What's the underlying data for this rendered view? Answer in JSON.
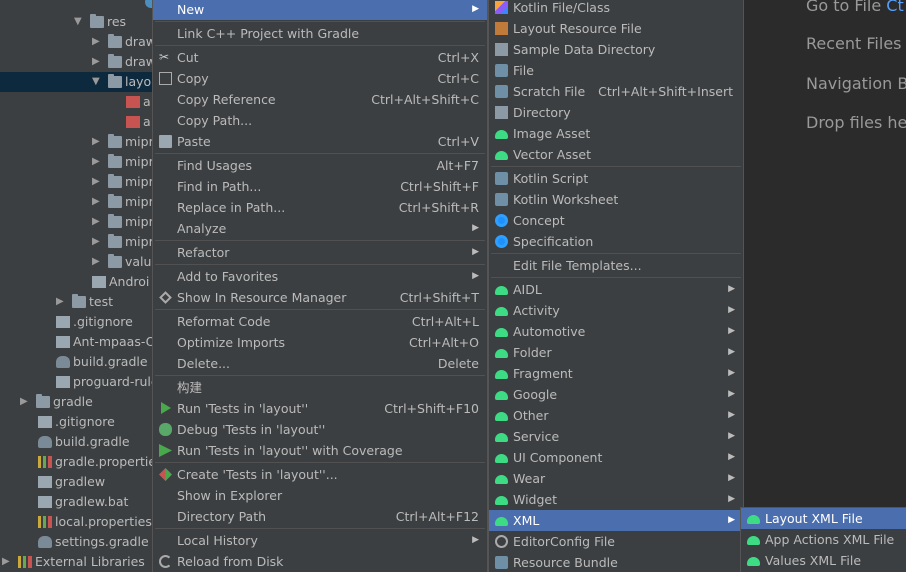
{
  "project_tree": [
    {
      "label": "",
      "depth": "kt",
      "arrow": "",
      "icon": "kotlin-class"
    },
    {
      "label": "res",
      "arrow": "▼",
      "icon": "folder"
    },
    {
      "label": "draw",
      "arrow": "▶",
      "icon": "folder"
    },
    {
      "label": "draw",
      "arrow": "▶",
      "icon": "folder"
    },
    {
      "label": "layo",
      "arrow": "▼",
      "icon": "folder",
      "selected": true
    },
    {
      "label": "a",
      "arrow": "",
      "icon": "xml"
    },
    {
      "label": "a",
      "arrow": "",
      "icon": "xml"
    },
    {
      "label": "mipr",
      "arrow": "▶",
      "icon": "folder"
    },
    {
      "label": "mipr",
      "arrow": "▶",
      "icon": "folder"
    },
    {
      "label": "mipr",
      "arrow": "▶",
      "icon": "folder"
    },
    {
      "label": "mipr",
      "arrow": "▶",
      "icon": "folder"
    },
    {
      "label": "mipr",
      "arrow": "▶",
      "icon": "folder"
    },
    {
      "label": "mipr",
      "arrow": "▶",
      "icon": "folder"
    },
    {
      "label": "valu",
      "arrow": "▶",
      "icon": "folder"
    },
    {
      "label": "Androi",
      "arrow": "",
      "icon": "manifest"
    },
    {
      "label": "test",
      "arrow": "▶",
      "icon": "folder"
    },
    {
      "label": ".gitignore",
      "arrow": "",
      "icon": "file"
    },
    {
      "label": "Ant-mpaas-O",
      "arrow": "",
      "icon": "file"
    },
    {
      "label": "build.gradle",
      "arrow": "",
      "icon": "gradle"
    },
    {
      "label": "proguard-rule",
      "arrow": "",
      "icon": "file"
    },
    {
      "label": "gradle",
      "arrow": "▶",
      "icon": "folder"
    },
    {
      "label": ".gitignore",
      "arrow": "",
      "icon": "file"
    },
    {
      "label": "build.gradle",
      "arrow": "",
      "icon": "gradle"
    },
    {
      "label": "gradle.propertie",
      "arrow": "",
      "icon": "bars"
    },
    {
      "label": "gradlew",
      "arrow": "",
      "icon": "file"
    },
    {
      "label": "gradlew.bat",
      "arrow": "",
      "icon": "file"
    },
    {
      "label": "local.properties",
      "arrow": "",
      "icon": "bars"
    },
    {
      "label": "settings.gradle",
      "arrow": "",
      "icon": "gradle"
    },
    {
      "label": "External Libraries",
      "arrow": "▶",
      "icon": "bars"
    }
  ],
  "welcome": {
    "goto_file": "Go to File",
    "goto_file_key": "Ct",
    "recent_files": "Recent Files",
    "navigation_bar": "Navigation Ba",
    "drop_files": "Drop files her"
  },
  "context_menu": [
    {
      "label": "New",
      "submenu": true,
      "active": true,
      "icon": ""
    },
    {
      "sep": true
    },
    {
      "label": "Link C++ Project with Gradle",
      "icon": ""
    },
    {
      "sep": true
    },
    {
      "label": "Cut",
      "shortcut": "Ctrl+X",
      "icon": "cut"
    },
    {
      "label": "Copy",
      "shortcut": "Ctrl+C",
      "icon": "copy"
    },
    {
      "label": "Copy Reference",
      "shortcut": "Ctrl+Alt+Shift+C",
      "icon": ""
    },
    {
      "label": "Copy Path...",
      "icon": ""
    },
    {
      "label": "Paste",
      "shortcut": "Ctrl+V",
      "icon": "paste"
    },
    {
      "sep": true
    },
    {
      "label": "Find Usages",
      "shortcut": "Alt+F7",
      "icon": ""
    },
    {
      "label": "Find in Path...",
      "shortcut": "Ctrl+Shift+F",
      "icon": ""
    },
    {
      "label": "Replace in Path...",
      "shortcut": "Ctrl+Shift+R",
      "icon": ""
    },
    {
      "label": "Analyze",
      "submenu": true,
      "icon": ""
    },
    {
      "sep": true
    },
    {
      "label": "Refactor",
      "submenu": true,
      "icon": ""
    },
    {
      "sep": true
    },
    {
      "label": "Add to Favorites",
      "submenu": true,
      "icon": ""
    },
    {
      "label": "Show In Resource Manager",
      "shortcut": "Ctrl+Shift+T",
      "icon": "find-resource"
    },
    {
      "sep": true
    },
    {
      "label": "Reformat Code",
      "shortcut": "Ctrl+Alt+L",
      "icon": ""
    },
    {
      "label": "Optimize Imports",
      "shortcut": "Ctrl+Alt+O",
      "icon": ""
    },
    {
      "label": "Delete...",
      "shortcut": "Delete",
      "icon": ""
    },
    {
      "sep": true
    },
    {
      "label": "构建",
      "icon": ""
    },
    {
      "label": "Run 'Tests in 'layout''",
      "shortcut": "Ctrl+Shift+F10",
      "icon": "play"
    },
    {
      "label": "Debug 'Tests in 'layout''",
      "icon": "bug"
    },
    {
      "label": "Run 'Tests in 'layout'' with Coverage",
      "icon": "coverage"
    },
    {
      "sep": true
    },
    {
      "label": "Create 'Tests in 'layout''...",
      "icon": "create"
    },
    {
      "label": "Show in Explorer",
      "icon": ""
    },
    {
      "label": "Directory Path",
      "shortcut": "Ctrl+Alt+F12",
      "icon": ""
    },
    {
      "sep": true
    },
    {
      "label": "Local History",
      "submenu": true,
      "icon": ""
    },
    {
      "label": "Reload from Disk",
      "icon": "reload"
    }
  ],
  "new_menu": [
    {
      "label": "Kotlin File/Class",
      "icon": "kt"
    },
    {
      "label": "Layout Resource File",
      "icon": "layout"
    },
    {
      "label": "Sample Data Directory",
      "icon": "dir"
    },
    {
      "label": "File",
      "icon": "scratch"
    },
    {
      "label": "Scratch File",
      "shortcut": "Ctrl+Alt+Shift+Insert",
      "icon": "scratch"
    },
    {
      "label": "Directory",
      "icon": "dir"
    },
    {
      "label": "Image Asset",
      "icon": "android"
    },
    {
      "label": "Vector Asset",
      "icon": "android"
    },
    {
      "sep": true
    },
    {
      "label": "Kotlin Script",
      "icon": "scratch"
    },
    {
      "label": "Kotlin Worksheet",
      "icon": "scratch"
    },
    {
      "label": "Concept",
      "icon": "blueball"
    },
    {
      "label": "Specification",
      "icon": "blueball"
    },
    {
      "sep": true
    },
    {
      "label": "Edit File Templates...",
      "icon": ""
    },
    {
      "sep": true
    },
    {
      "label": "AIDL",
      "submenu": true,
      "icon": "android"
    },
    {
      "label": "Activity",
      "submenu": true,
      "icon": "android"
    },
    {
      "label": "Automotive",
      "submenu": true,
      "icon": "android"
    },
    {
      "label": "Folder",
      "submenu": true,
      "icon": "android"
    },
    {
      "label": "Fragment",
      "submenu": true,
      "icon": "android"
    },
    {
      "label": "Google",
      "submenu": true,
      "icon": "android"
    },
    {
      "label": "Other",
      "submenu": true,
      "icon": "android"
    },
    {
      "label": "Service",
      "submenu": true,
      "icon": "android"
    },
    {
      "label": "UI Component",
      "submenu": true,
      "icon": "android"
    },
    {
      "label": "Wear",
      "submenu": true,
      "icon": "android"
    },
    {
      "label": "Widget",
      "submenu": true,
      "icon": "android"
    },
    {
      "label": "XML",
      "submenu": true,
      "icon": "android",
      "active": true
    },
    {
      "label": "EditorConfig File",
      "icon": "gear"
    },
    {
      "label": "Resource Bundle",
      "icon": "scratch"
    }
  ],
  "xml_menu": [
    {
      "label": "Layout XML File",
      "icon": "android",
      "active": true
    },
    {
      "label": "App Actions XML File",
      "icon": "android"
    },
    {
      "label": "Values XML File",
      "icon": "android"
    }
  ],
  "colors": {
    "menu_bg": "#3c3f41",
    "highlight": "#4b6eaf",
    "android_green": "#3ddc84"
  }
}
